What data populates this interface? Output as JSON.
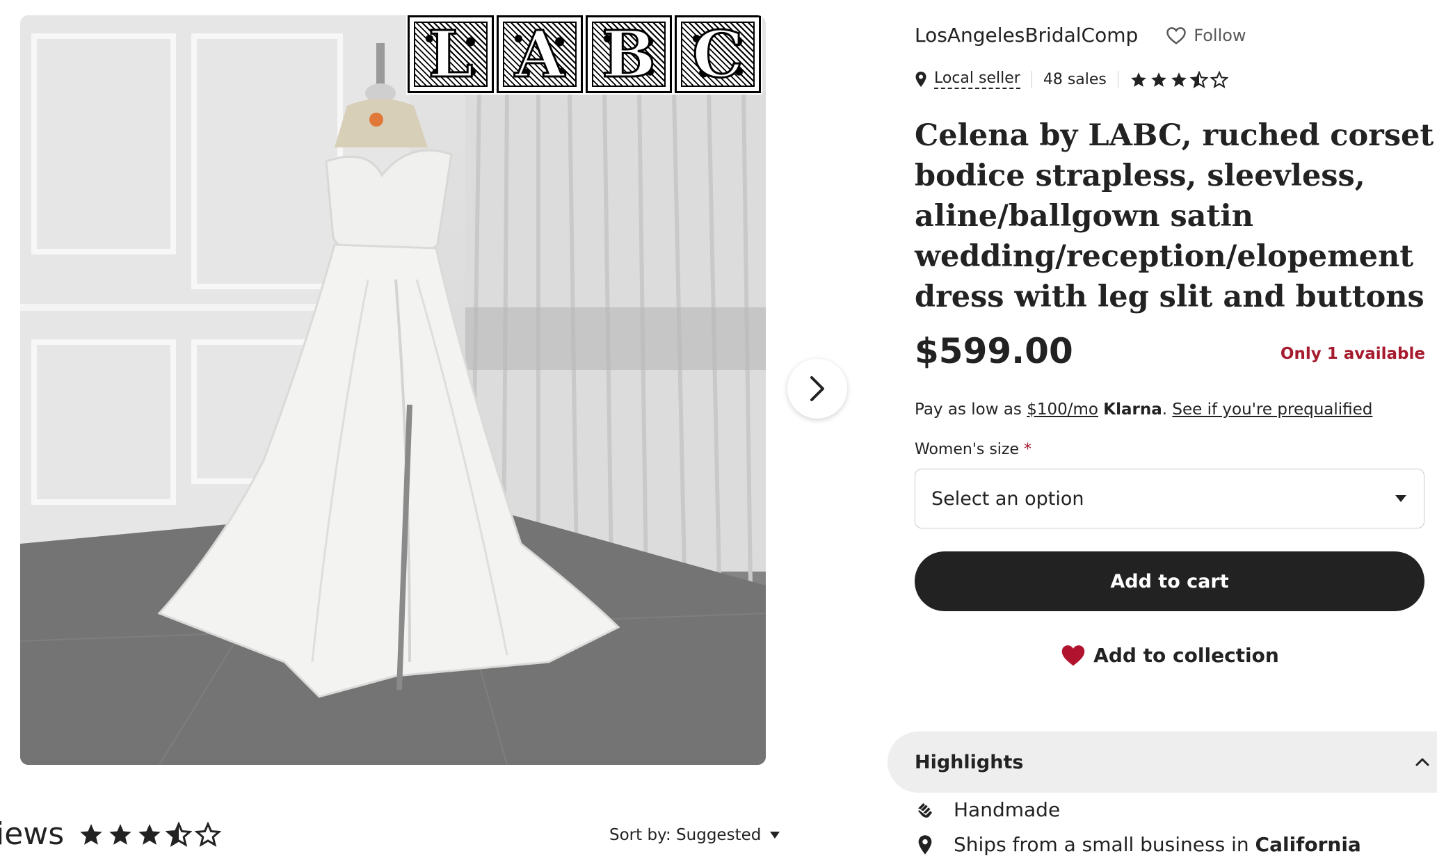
{
  "gallery": {
    "logo_letters": [
      "L",
      "A",
      "B",
      "C"
    ],
    "next_icon": "chevron-right-icon"
  },
  "reviews": {
    "label": "iews",
    "rating_stars": 3.5,
    "sort_label": "Sort by: Suggested"
  },
  "shop": {
    "name": "LosAngelesBridalComp",
    "follow_label": "Follow",
    "local_seller_label": "Local seller",
    "sales": "48 sales",
    "rating_stars": 3.5
  },
  "listing": {
    "title": "Celena by LABC, ruched corset bodice strapless, sleevless, aline/ballgown satin wedding/reception/elopement dress with leg slit and buttons",
    "price": "$599.00",
    "stock": "Only 1 available"
  },
  "klarna": {
    "prefix": "Pay as low as ",
    "amount": "$100/mo",
    "brand": "Klarna",
    "dot": ".",
    "prequalify": "See if you're prequalified"
  },
  "size": {
    "label": "Women's size",
    "required_mark": "*",
    "selected": "Select an option"
  },
  "actions": {
    "add_to_cart": "Add to cart",
    "add_to_collection": "Add to collection"
  },
  "highlights": {
    "title": "Highlights",
    "items": [
      {
        "icon": "hand-icon",
        "text": "Handmade",
        "bold": ""
      },
      {
        "icon": "location-pin-icon",
        "text": "Ships from a small business in ",
        "bold": "California"
      }
    ]
  },
  "colors": {
    "dark": "#222222",
    "accent_red": "#a61a2e",
    "panel_gray": "#eeeeee"
  }
}
